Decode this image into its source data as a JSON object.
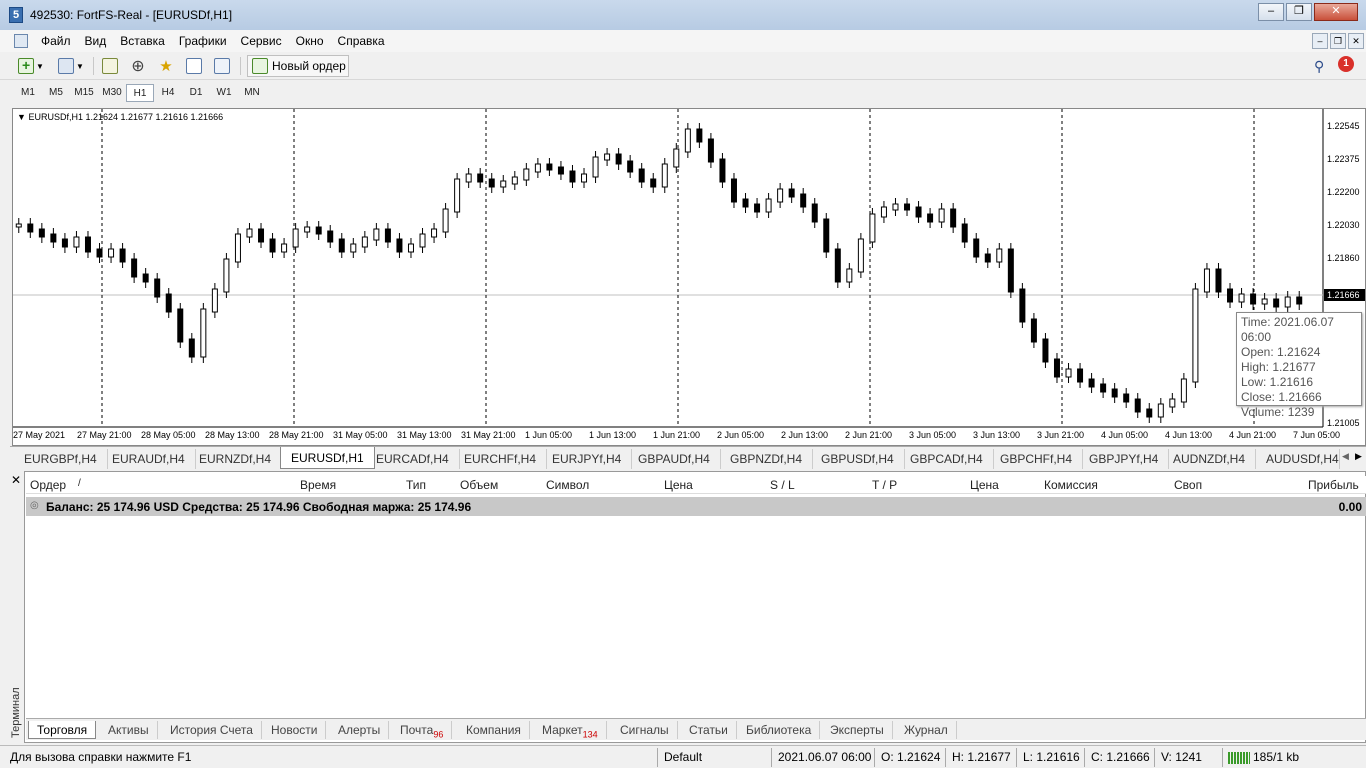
{
  "window": {
    "title": "492530: FortFS-Real - [EURUSDf,H1]",
    "app_icon": "5"
  },
  "menu": [
    "Файл",
    "Вид",
    "Вставка",
    "Графики",
    "Сервис",
    "Окно",
    "Справка"
  ],
  "toolbar": {
    "new_order_label": "Новый ордер",
    "notification_count": "1"
  },
  "timeframes": [
    "M1",
    "M5",
    "M15",
    "M30",
    "H1",
    "H4",
    "D1",
    "W1",
    "MN"
  ],
  "active_timeframe": "H1",
  "chart": {
    "header": "EURUSDf,H1  1.21624 1.21677 1.21616 1.21666",
    "price_labels": [
      "1.22545",
      "1.22375",
      "1.22200",
      "1.22030",
      "1.21860",
      "1.21005"
    ],
    "current_price": "1.21666",
    "time_labels": [
      "27 May 2021",
      "27 May 21:00",
      "28 May 05:00",
      "28 May 13:00",
      "28 May 21:00",
      "31 May 05:00",
      "31 May 13:00",
      "31 May 21:00",
      "1 Jun 05:00",
      "1 Jun 13:00",
      "1 Jun 21:00",
      "2 Jun 05:00",
      "2 Jun 13:00",
      "2 Jun 21:00",
      "3 Jun 05:00",
      "3 Jun 13:00",
      "3 Jun 21:00",
      "4 Jun 05:00",
      "4 Jun 13:00",
      "4 Jun 21:00",
      "7 Jun 05:00"
    ],
    "tooltip": {
      "time": "Time: 2021.06.07 06:00",
      "open": "Open: 1.21624",
      "high": "High: 1.21677",
      "low": "Low:  1.21616",
      "close": "Close: 1.21666",
      "volume": "Volume: 1239"
    }
  },
  "chart_tabs": [
    "EURGBPf,H4",
    "EURAUDf,H4",
    "EURNZDf,H4",
    "EURUSDf,H1",
    "EURCADf,H4",
    "EURCHFf,H4",
    "EURJPYf,H4",
    "GBPAUDf,H4",
    "GBPNZDf,H4",
    "GBPUSDf,H4",
    "GBPCADf,H4",
    "GBPCHFf,H4",
    "GBPJPYf,H4",
    "AUDNZDf,H4",
    "AUDUSDf,H4"
  ],
  "active_chart_tab": "EURUSDf,H1",
  "terminal": {
    "columns": [
      "Ордер",
      "/",
      "Время",
      "Тип",
      "Объем",
      "Символ",
      "Цена",
      "S / L",
      "T / P",
      "Цена",
      "Комиссия",
      "Своп",
      "Прибыль"
    ],
    "balance_text": "Баланс: 25 174.96 USD  Средства: 25 174.96  Свободная маржа: 25 174.96",
    "profit": "0.00",
    "side_label": "Терминал",
    "tabs": [
      {
        "label": "Торговля",
        "badge": ""
      },
      {
        "label": "Активы",
        "badge": ""
      },
      {
        "label": "История Счета",
        "badge": ""
      },
      {
        "label": "Новости",
        "badge": ""
      },
      {
        "label": "Алерты",
        "badge": ""
      },
      {
        "label": "Почта",
        "badge": "96"
      },
      {
        "label": "Компания",
        "badge": ""
      },
      {
        "label": "Маркет",
        "badge": "134"
      },
      {
        "label": "Сигналы",
        "badge": ""
      },
      {
        "label": "Статьи",
        "badge": ""
      },
      {
        "label": "Библиотека",
        "badge": ""
      },
      {
        "label": "Эксперты",
        "badge": ""
      },
      {
        "label": "Журнал",
        "badge": ""
      }
    ]
  },
  "status": {
    "help": "Для вызова справки нажмите F1",
    "profile": "Default",
    "datetime": "2021.06.07 06:00",
    "open": "O: 1.21624",
    "high": "H: 1.21677",
    "low": "L: 1.21616",
    "close": "C: 1.21666",
    "volume": "V: 1241",
    "traffic": "185/1 kb"
  }
}
